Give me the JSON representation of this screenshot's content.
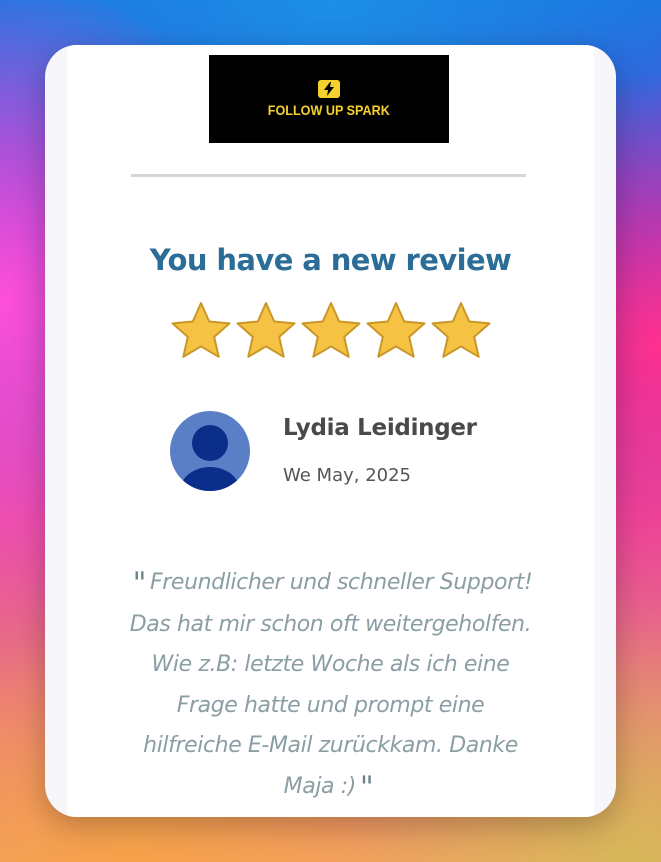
{
  "logo": {
    "text": "FOLLOW UP SPARK",
    "icon": "lightning-bolt-icon",
    "background_color": "#000000",
    "text_color": "#f5d12f"
  },
  "heading": {
    "title": "You have a new review",
    "color": "#2b6d97"
  },
  "rating": {
    "value": 5,
    "max": 5,
    "star_color": "#f6c244",
    "star_outline_color": "#c99728"
  },
  "reviewer": {
    "name": "Lydia Leidinger",
    "date": "We May, 2025",
    "avatar_icon": "person-avatar-icon",
    "avatar_bg_color": "#5b7fc6",
    "avatar_fg_color": "#0b2e8a"
  },
  "review": {
    "open_quote": "\"",
    "text": "Freundlicher und schneller Support! Das hat mir schon oft weitergeholfen. Wie z.B: letzte Woche als ich eine Frage hatte und prompt eine hilfreiche E-Mail zurückkam. Danke Maja :)",
    "close_quote": "\"",
    "color": "#8a9ea4"
  }
}
